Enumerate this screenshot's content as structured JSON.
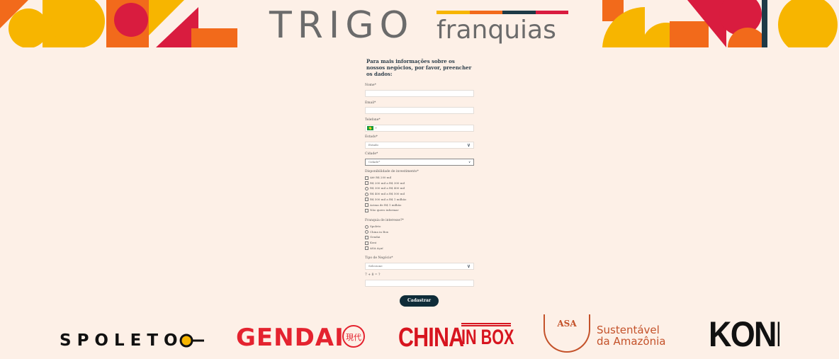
{
  "brand": {
    "name": "TRIGO",
    "subtitle": "franquias",
    "bar_colors": [
      "#f7b500",
      "#f26a1b",
      "#1e3a46",
      "#d91c3f"
    ]
  },
  "form": {
    "intro": "Para mais informações sobre os nossos negócios, por favor, preencher os dados:",
    "nome_label": "Nome*",
    "email_label": "Email*",
    "telefone_label": "Telefone*",
    "telefone_prefix": "+",
    "estado_label": "Estado*",
    "estado_value": "Estado",
    "cidade_label": "Cidade*",
    "cidade_value": "Cidade*",
    "investimento_label": "Disponibilidade de investimento*",
    "investimento_options": [
      "Até R$ 200 mil",
      "R$ 200 mil a R$ 300 mil",
      "R$ 300 mil a R$ 400 mil",
      "R$ 400 mil a R$ 500 mil",
      "R$ 500 mil a R$ 1 milhão",
      "Acima de R$ 1 milhão",
      "Não quero informar"
    ],
    "franquia_label": "Franquia de interesse?*",
    "franquia_options": [
      "Spoleto",
      "China in Box",
      "Gendai",
      "Koni",
      "ASA Açaí"
    ],
    "tipo_label": "Tipo de Negócio*",
    "tipo_value": "Selecione",
    "captcha_label": "7 + 8 = ?",
    "submit_label": "Cadastrar"
  },
  "brands": {
    "spoleto": "SPOLETO",
    "gendai": "GENDAI",
    "gendai_seal": "現代",
    "china": "CHINA",
    "inbox": "IN BOX",
    "asa": "ASA",
    "sustentavel1": "Sustentável",
    "sustentavel2": "da Amazônia",
    "koni": "KONI"
  }
}
